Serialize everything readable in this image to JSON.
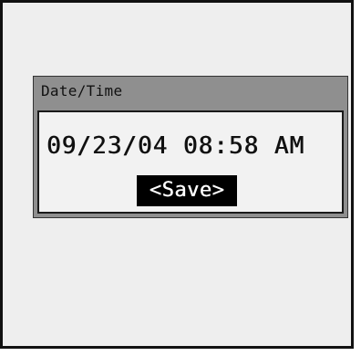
{
  "dialog": {
    "title": "Date/Time",
    "datetime_value": "09/23/04 08:58 AM",
    "save_label": "<Save>"
  },
  "colors": {
    "screen_background": "#eeeeee",
    "dialog_header": "#8f8f8f",
    "dialog_body": "#f2f2f2",
    "button_selected_bg": "#000000",
    "button_selected_text": "#ffffff"
  }
}
